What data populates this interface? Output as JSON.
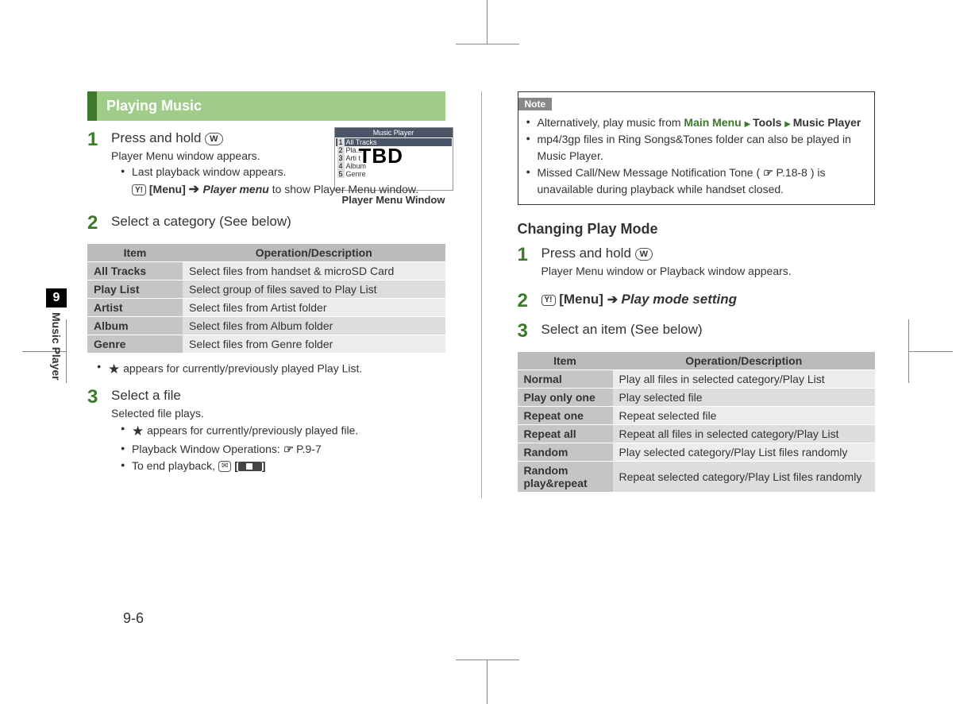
{
  "page_number": "9-6",
  "side_tab": {
    "num": "9",
    "label": "Music Player"
  },
  "left": {
    "heading": "Playing Music",
    "step1": {
      "num": "1",
      "title_prefix": "Press and hold ",
      "key_icon": "W",
      "sub": "Player Menu window appears.",
      "bullet1_prefix": "Last playback window appears. ",
      "bullet1_menu_btn": "Y!",
      "bullet1_menu_label": "[Menu]",
      "bullet1_arrow": " ➔ ",
      "bullet1_player_menu": "Player menu",
      "bullet1_suffix": " to show Player Menu window."
    },
    "screenshot": {
      "title": "Music Player",
      "items": [
        "All Tracks",
        "Pla...",
        "Arti t",
        "Album",
        "Genre"
      ],
      "tbd": "TBD",
      "caption": "Player Menu Window"
    },
    "step2": {
      "num": "2",
      "title": "Select a category (See below)"
    },
    "table1": {
      "headers": [
        "Item",
        "Operation/Description"
      ],
      "rows": [
        [
          "All Tracks",
          "Select files from handset & microSD Card"
        ],
        [
          "Play List",
          "Select group of files saved to Play List"
        ],
        [
          "Artist",
          "Select files from Artist folder"
        ],
        [
          "Album",
          "Select files from Album folder"
        ],
        [
          "Genre",
          "Select files from Genre folder"
        ]
      ]
    },
    "after_table1_bullet": " appears for currently/previously played Play List.",
    "step3": {
      "num": "3",
      "title": "Select a file",
      "sub": "Selected file plays.",
      "bullets": {
        "b1_star_suffix": " appears for currently/previously played file.",
        "b2_prefix": "Playback Window Operations: ",
        "b2_ref": "P.9-7",
        "b3_prefix": "To end playback, "
      }
    }
  },
  "right": {
    "note_label": "Note",
    "note_items": {
      "n1_prefix": "Alternatively, play music from ",
      "n1_green1": "Main Menu",
      "n1_tools": "Tools",
      "n1_mp": "Music Player",
      "n2": "mp4/3gp files in Ring Songs&Tones folder can also be played in Music Player.",
      "n3_prefix": "Missed Call/New Message Notification Tone (",
      "n3_ref": "P.18-8",
      "n3_suffix": ") is unavailable during playback while handset closed."
    },
    "subheading": "Changing Play Mode",
    "step1": {
      "num": "1",
      "title_prefix": "Press and hold ",
      "key_icon": "W",
      "sub": "Player Menu window or Playback window appears."
    },
    "step2": {
      "num": "2",
      "menu_btn": "Y!",
      "menu_label": "[Menu]",
      "arrow": " ➔ ",
      "setting": "Play mode setting"
    },
    "step3": {
      "num": "3",
      "title": "Select an item (See below)"
    },
    "table2": {
      "headers": [
        "Item",
        "Operation/Description"
      ],
      "rows": [
        [
          "Normal",
          "Play all files in selected category/Play List"
        ],
        [
          "Play only one",
          "Play selected file"
        ],
        [
          "Repeat one",
          "Repeat selected file"
        ],
        [
          "Repeat all",
          "Repeat all files in selected category/Play List"
        ],
        [
          "Random",
          "Play selected category/Play List files randomly"
        ],
        [
          "Random play&repeat",
          "Repeat selected category/Play List files randomly"
        ]
      ]
    }
  }
}
